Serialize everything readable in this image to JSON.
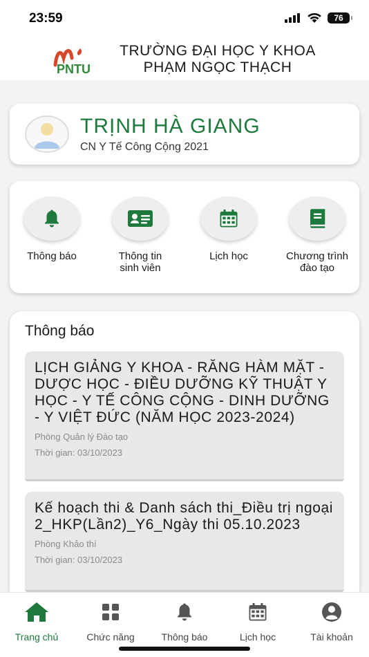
{
  "status_bar": {
    "time": "23:59",
    "battery": "76"
  },
  "header": {
    "school_line1": "TRƯỜNG ĐẠI HỌC Y KHOA",
    "school_line2": "PHẠM NGỌC THẠCH",
    "logo_text": "PNTU"
  },
  "profile": {
    "name": "TRỊNH HÀ GIANG",
    "class": "CN Y Tế Công Cộng 2021"
  },
  "menu": {
    "items": [
      {
        "line1": "Thông báo",
        "line2": "",
        "icon": "bell-icon"
      },
      {
        "line1": "Thông tin",
        "line2": "sinh viên",
        "icon": "id-card-icon"
      },
      {
        "line1": "Lịch học",
        "line2": "",
        "icon": "calendar-icon"
      },
      {
        "line1": "Chương trình",
        "line2": "đào tạo",
        "icon": "book-icon"
      }
    ]
  },
  "news": {
    "title": "Thông báo",
    "items": [
      {
        "title": "LỊCH GIẢNG Y KHOA - RĂNG HÀM MẶT - DƯỢC HỌC - ĐIỀU DƯỠNG KỸ THUẬT Y HỌC - Y TẾ CÔNG CỘNG - DINH DƯỠNG - Y VIỆT ĐỨC (NĂM HỌC 2023-2024)",
        "department": "Phòng Quản lý Đào tạo",
        "time": "Thời gian: 03/10/2023"
      },
      {
        "title": "Kế hoạch thi & Danh sách thi_Điều trị ngoại 2_HKP(Lần2)_Y6_Ngày thi 05.10.2023",
        "department": "Phòng Khảo thí",
        "time": "Thời gian: 03/10/2023"
      }
    ]
  },
  "bottom_nav": {
    "items": [
      {
        "label": "Trang chủ",
        "icon": "home-icon",
        "active": true
      },
      {
        "label": "Chức năng",
        "icon": "grid-icon",
        "active": false
      },
      {
        "label": "Thông báo",
        "icon": "bell-icon",
        "active": false
      },
      {
        "label": "Lịch học",
        "icon": "calendar-icon",
        "active": false
      },
      {
        "label": "Tài khoản",
        "icon": "account-icon",
        "active": false
      }
    ]
  },
  "colors": {
    "accent": "#1e7a3c",
    "icon_gray": "#555555",
    "logo_red": "#d9472b",
    "logo_green": "#2e8b3a"
  }
}
